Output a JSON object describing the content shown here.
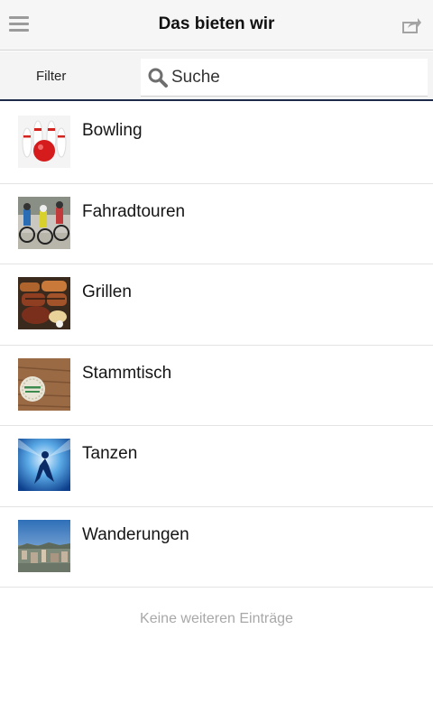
{
  "header": {
    "title": "Das bieten wir",
    "menu_icon": "hamburger-menu-icon",
    "share_icon": "share-icon"
  },
  "toolbar": {
    "filter_label": "Filter",
    "search_placeholder": "Suche",
    "search_icon": "search-icon"
  },
  "list": {
    "items": [
      {
        "label": "Bowling"
      },
      {
        "label": "Fahradtouren"
      },
      {
        "label": "Grillen"
      },
      {
        "label": "Stammtisch"
      },
      {
        "label": "Tanzen"
      },
      {
        "label": "Wanderungen"
      }
    ]
  },
  "footer": {
    "note": "Keine weiteren Einträge"
  },
  "colors": {
    "header_bg": "#f6f6f6",
    "toolbar_bg": "#f4f4f4",
    "accent_line": "#1e2a4a",
    "muted_text": "#a8a8a8"
  }
}
